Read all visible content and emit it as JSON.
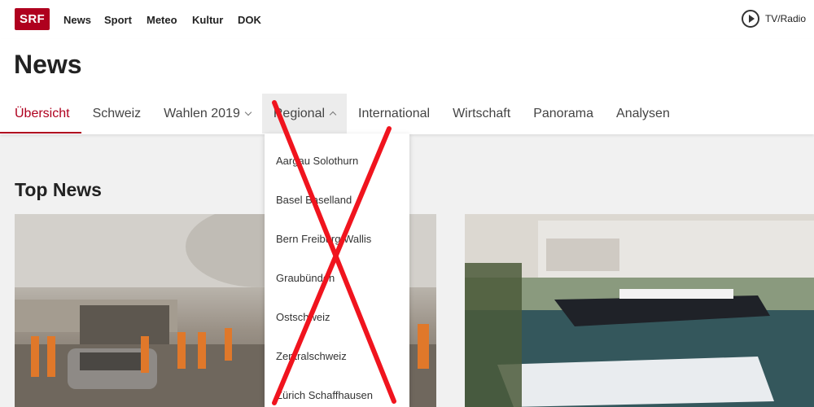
{
  "header": {
    "logo_text": "SRF",
    "nav": [
      "News",
      "Sport",
      "Meteo",
      "Kultur",
      "DOK"
    ],
    "tvradio_label": "TV/Radio"
  },
  "page": {
    "title": "News",
    "subnav": [
      {
        "label": "Übersicht",
        "state": "active"
      },
      {
        "label": "Schweiz"
      },
      {
        "label": "Wahlen 2019",
        "chevron": "down"
      },
      {
        "label": "Regional",
        "chevron": "up",
        "state": "open"
      },
      {
        "label": "International"
      },
      {
        "label": "Wirtschaft"
      },
      {
        "label": "Panorama"
      },
      {
        "label": "Analysen"
      }
    ]
  },
  "dropdown": {
    "items": [
      "Aargau Solothurn",
      "Basel Baselland",
      "Bern Freiburg Wallis",
      "Graubünden",
      "Ostschweiz",
      "Zentralschweiz",
      "Zürich Schaffhausen"
    ]
  },
  "main": {
    "section_title": "Top News"
  },
  "colors": {
    "brand": "#af001e",
    "annotation_x": "#f0141e"
  }
}
